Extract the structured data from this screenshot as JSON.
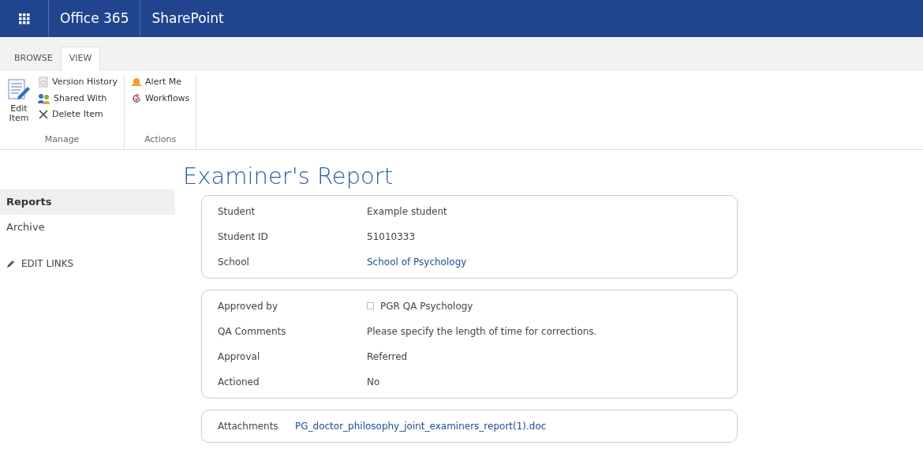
{
  "suite_bar": {
    "brand": "Office 365",
    "app": "SharePoint"
  },
  "ribbon_tabs": [
    {
      "label": "BROWSE",
      "selected": false
    },
    {
      "label": "VIEW",
      "selected": true
    }
  ],
  "ribbon_groups": [
    {
      "label": "Manage",
      "large": {
        "label": "Edit Item"
      },
      "items": [
        {
          "label": "Version History"
        },
        {
          "label": "Shared With"
        },
        {
          "label": "Delete Item"
        }
      ]
    },
    {
      "label": "Actions",
      "items": [
        {
          "label": "Alert Me"
        },
        {
          "label": "Workflows"
        }
      ]
    }
  ],
  "nav": {
    "items": [
      {
        "label": "Reports",
        "selected": true
      },
      {
        "label": "Archive",
        "selected": false
      }
    ],
    "edit_links": "EDIT LINKS"
  },
  "title": "Examiner's Report",
  "sections": [
    {
      "fields": [
        {
          "label": "Student",
          "value": "Example student",
          "kind": "text"
        },
        {
          "label": "Student ID",
          "value": "51010333",
          "kind": "text"
        },
        {
          "label": "School",
          "value": "School of Psychology",
          "kind": "link"
        }
      ]
    },
    {
      "fields": [
        {
          "label": "Approved by",
          "value": "PGR QA Psychology",
          "kind": "person"
        },
        {
          "label": "QA Comments",
          "value": "Please specify the length of time for corrections.",
          "kind": "text"
        },
        {
          "label": "Approval",
          "value": "Referred",
          "kind": "text"
        },
        {
          "label": "Actioned",
          "value": "No",
          "kind": "text"
        }
      ]
    },
    {
      "fields": [
        {
          "label": "Attachments",
          "value": "PG_doctor_philosophy_joint_examiners_report(1).doc",
          "kind": "attachment"
        }
      ]
    }
  ]
}
